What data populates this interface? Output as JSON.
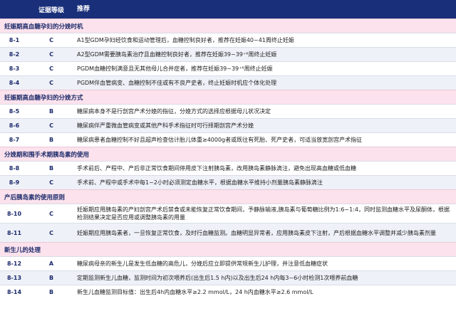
{
  "header": {
    "col_grade": "证据等级",
    "col_rec": "推荐"
  },
  "sections": [
    {
      "title": "妊娠期高血糖孕妇的分娩时机",
      "rows": [
        {
          "id": "8-1",
          "grade": "C",
          "text": "A1型GDM孕妇经饮食和运动管理后，血糖控制良好者，推荐在妊娠40~41周终止妊娠"
        },
        {
          "id": "8-2",
          "grade": "C",
          "text": "A2型GDM需要胰岛素治疗且血糖控制良好者，推荐在妊娠39~39⁺⁶周终止妊娠"
        },
        {
          "id": "8-3",
          "grade": "C",
          "text": "PGDM血糖控制满意且无其他母儿合并症者，推荐在妊娠39~39⁺⁶周终止妊娠"
        },
        {
          "id": "8-4",
          "grade": "C",
          "text": "PGDM伴血管病变、血糖控制不佳或有不良产史者，终止妊娠时机应个体化处理"
        }
      ]
    },
    {
      "title": "妊娠期高血糖孕妇的分娩方式",
      "rows": [
        {
          "id": "8-5",
          "grade": "B",
          "text": "糖尿病本身不是行剖宫产术分娩的指征，分娩方式的选择应根据母儿状况决定"
        },
        {
          "id": "8-6",
          "grade": "C",
          "text": "糖尿病伴严重微血管病变或其他产科手术指征时可行择期剖宫产术分娩"
        },
        {
          "id": "8-7",
          "grade": "B",
          "text": "糖尿病患者血糖控制不好且超声检查估计胎儿体重≥4000g者或既往有死胎、死产史者，可适当放宽剖宫产术指征"
        }
      ]
    },
    {
      "title": "分娩期和围手术期胰岛素的使用",
      "rows": [
        {
          "id": "8-8",
          "grade": "B",
          "text": "手术前后、产程中、产后非正常饮食期间停用皮下注射胰岛素，改用胰岛素静脉滴注，避免出现高血糖或低血糖"
        },
        {
          "id": "8-9",
          "grade": "C",
          "text": "手术前、产程中或手术中每1~2小时必须测定血糖水平，根据血糖水平维持小剂量胰岛素静脉滴注"
        }
      ]
    },
    {
      "title": "产后胰岛素的使用原则",
      "rows": [
        {
          "id": "8-10",
          "grade": "C",
          "text": "妊娠期应用胰岛素的产妇剖宫产术后禁食或未能恢复正常饮食期间，予静脉输液,胰岛素与葡萄糖比例为1:6~1:4，同时监测血糖水平及尿酮体，根据检测结果决定是否应用或调整胰岛素的用量"
        },
        {
          "id": "8-11",
          "grade": "C",
          "text": "妊娠期应用胰岛素者，一旦恢复正常饮食，及时行血糖监测。血糖明显异常者，应用胰岛素皮下注射，产后根据血糖水平调整并减少胰岛素剂量"
        }
      ]
    },
    {
      "title": "新生儿的处理",
      "rows": [
        {
          "id": "8-12",
          "grade": "A",
          "text": "糖尿病母亲的新生儿是发生低血糖的高危儿，分娩后应立即提供常规新生儿护理，并注意低血糖症状"
        },
        {
          "id": "8-13",
          "grade": "B",
          "text": "定期监测新生儿血糖，监测时间为初次喂养后(出生后1.5 h内)以及出生后24 h内每3~6小时检测1次喂养前血糖"
        },
        {
          "id": "8-14",
          "grade": "B",
          "text": "新生儿血糖监测目标值：出生后4h内血糖水平≥2.2 mmol/L，24 h内血糖水平≥2.6 mmol/L"
        }
      ]
    }
  ]
}
